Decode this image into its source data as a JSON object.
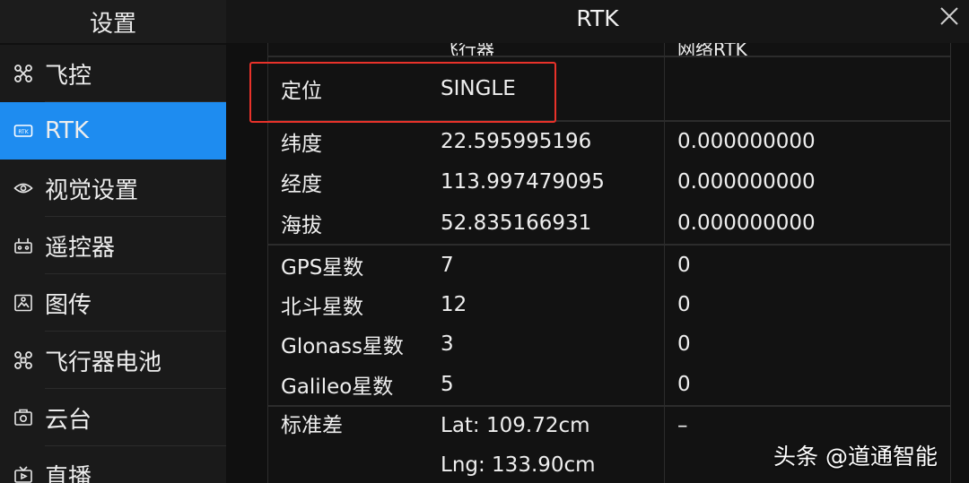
{
  "header": {
    "settings_title": "设置",
    "page_title": "RTK",
    "close_icon": "close-icon"
  },
  "sidebar": {
    "items": [
      {
        "label": "飞控",
        "icon": "drone-icon",
        "active": false
      },
      {
        "label": "RTK",
        "icon": "rtk-icon",
        "active": true
      },
      {
        "label": "视觉设置",
        "icon": "eye-icon",
        "active": false
      },
      {
        "label": "遥控器",
        "icon": "remote-controller-icon",
        "active": false
      },
      {
        "label": "图传",
        "icon": "image-transmission-icon",
        "active": false
      },
      {
        "label": "飞行器电池",
        "icon": "aircraft-battery-icon",
        "active": false
      },
      {
        "label": "云台",
        "icon": "gimbal-icon",
        "active": false
      },
      {
        "label": "直播",
        "icon": "live-stream-icon",
        "active": false
      }
    ]
  },
  "table": {
    "header_cut": {
      "col2": "飞行器",
      "col3": "网络RTK"
    },
    "rows": [
      {
        "label": "定位",
        "aircraft": "SINGLE",
        "network": ""
      },
      {
        "label": "纬度",
        "aircraft": "22.595995196",
        "network": "0.000000000"
      },
      {
        "label": "经度",
        "aircraft": "113.997479095",
        "network": "0.000000000"
      },
      {
        "label": "海拔",
        "aircraft": "52.835166931",
        "network": "0.000000000"
      },
      {
        "label": "GPS星数",
        "aircraft": "7",
        "network": "0"
      },
      {
        "label": "北斗星数",
        "aircraft": "12",
        "network": "0"
      },
      {
        "label": "Glonass星数",
        "aircraft": "3",
        "network": "0"
      },
      {
        "label": "Galileo星数",
        "aircraft": "5",
        "network": "0"
      }
    ],
    "std_dev": {
      "label": "标准差",
      "lat": "Lat: 109.72cm",
      "lng": "Lng: 133.90cm",
      "network": "–"
    }
  },
  "watermark": "头条 @道通智能",
  "colors": {
    "accent": "#1e8cf0",
    "highlight": "#e8322a"
  }
}
